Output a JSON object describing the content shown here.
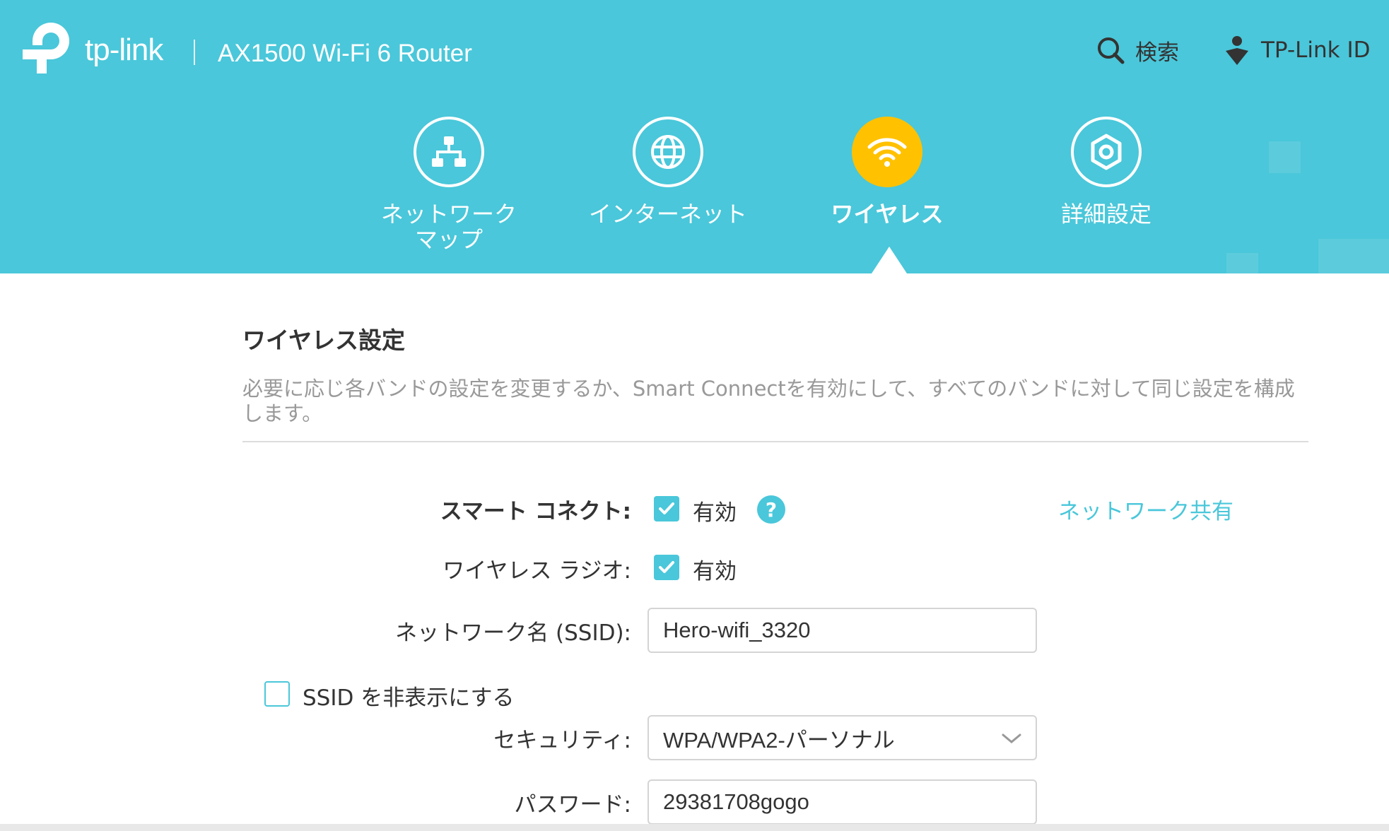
{
  "header": {
    "brand": "tp-link",
    "model": "AX1500 Wi-Fi 6 Router",
    "search_label": "検索",
    "id_label": "TP-Link ID",
    "bg_color": "#4ac7da"
  },
  "nav": {
    "items": [
      {
        "line1": "ネットワーク",
        "line2": "マップ",
        "icon": "network-map-icon"
      },
      {
        "line1": "インターネット",
        "icon": "globe-icon"
      },
      {
        "line1": "ワイヤレス",
        "icon": "wifi-icon",
        "active": true
      },
      {
        "line1": "詳細設定",
        "icon": "gear-icon"
      }
    ],
    "active_color": "#ffc100"
  },
  "section": {
    "title": "ワイヤレス設定",
    "description": "必要に応じ各バンドの設定を変更するか、Smart Connectを有効にして、すべてのバンドに対して同じ設定を構成します。"
  },
  "form": {
    "smart_connect": {
      "label": "スマート コネクト:",
      "checkbox_label": "有効",
      "checked": true
    },
    "help_glyph": "?",
    "share_link": "ネットワーク共有",
    "radio": {
      "label": "ワイヤレス ラジオ:",
      "checkbox_label": "有効",
      "checked": true
    },
    "ssid": {
      "label": "ネットワーク名 (SSID):",
      "value": "Hero-wifi_3320"
    },
    "hide_ssid": {
      "label": "SSID を非表示にする",
      "checked": false
    },
    "security": {
      "label": "セキュリティ:",
      "value": "WPA/WPA2-パーソナル"
    },
    "password": {
      "label": "パスワード:",
      "value": "29381708gogo"
    }
  }
}
